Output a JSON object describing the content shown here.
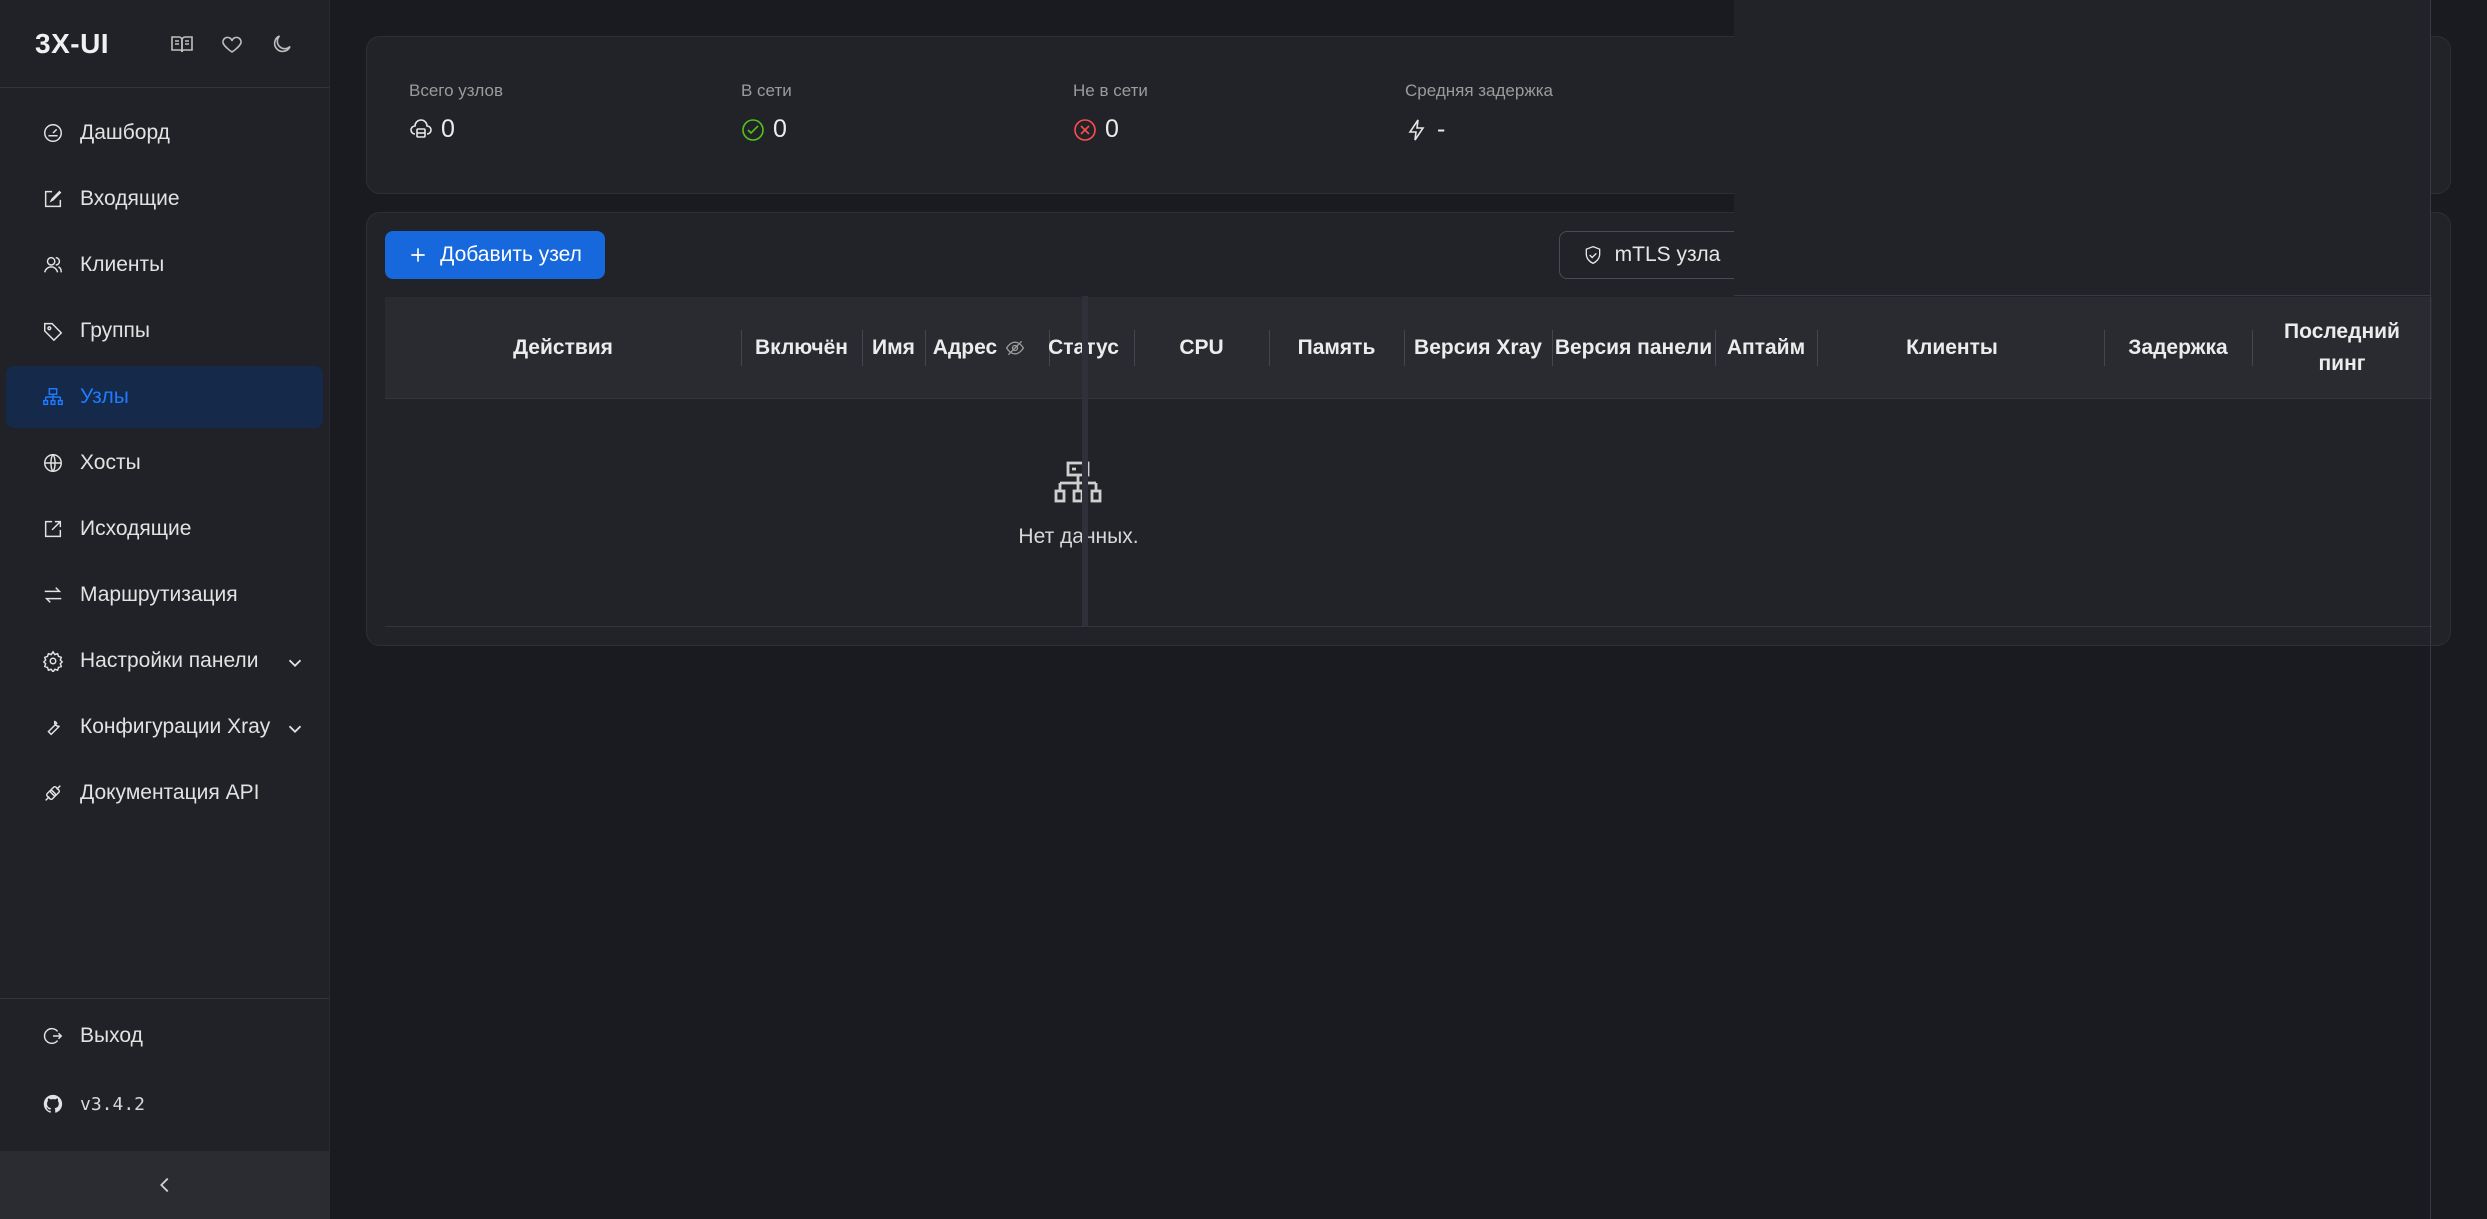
{
  "app": {
    "title": "3X-UI"
  },
  "sidebar": {
    "items": [
      {
        "label": "Дашборд",
        "icon": "dashboard-icon"
      },
      {
        "label": "Входящие",
        "icon": "edit-icon"
      },
      {
        "label": "Клиенты",
        "icon": "users-icon"
      },
      {
        "label": "Группы",
        "icon": "tag-icon"
      },
      {
        "label": "Узлы",
        "icon": "cluster-icon",
        "active": true
      },
      {
        "label": "Хосты",
        "icon": "globe-icon"
      },
      {
        "label": "Исходящие",
        "icon": "export-icon"
      },
      {
        "label": "Маршрутизация",
        "icon": "swap-icon"
      },
      {
        "label": "Настройки панели",
        "icon": "gear-icon",
        "expandable": true
      },
      {
        "label": "Конфигурации Xray",
        "icon": "tool-icon",
        "expandable": true
      },
      {
        "label": "Документация API",
        "icon": "api-icon"
      }
    ],
    "logout": "Выход",
    "version": "v3.4.2"
  },
  "stats": {
    "total": {
      "label": "Всего узлов",
      "value": "0"
    },
    "online": {
      "label": "В сети",
      "value": "0"
    },
    "offline": {
      "label": "Не в сети",
      "value": "0"
    },
    "latency": {
      "label": "Средняя задержка",
      "value": "-"
    }
  },
  "toolbar": {
    "add_label": "Добавить узел",
    "mtls_label": "mTLS узла"
  },
  "table": {
    "columns": [
      "Действия",
      "Включён",
      "Имя",
      "Адрес",
      "Статус",
      "CPU",
      "Память",
      "Версия Xray",
      "Версия панели",
      "Аптайм",
      "Клиенты",
      "Задержка",
      "Последний пинг"
    ],
    "empty_text": "Нет данных."
  },
  "colors": {
    "accent": "#1668dc",
    "active_text": "#1f7aff",
    "active_bg": "#15294a",
    "online": "#52c41a",
    "offline": "#ff4d4f"
  }
}
